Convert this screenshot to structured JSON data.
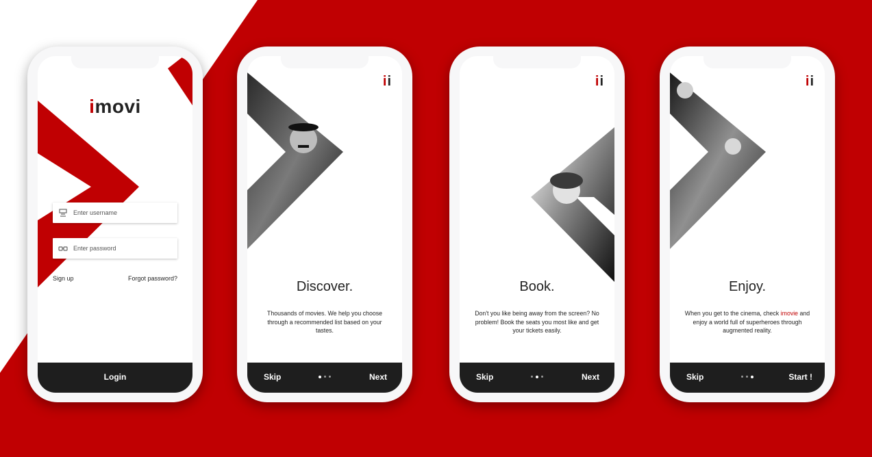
{
  "screens": [
    {
      "type": "login",
      "logo": {
        "accent": "i",
        "rest": "movi"
      },
      "username_placeholder": "Enter username",
      "password_placeholder": "Enter password",
      "signup_label": "Sign up",
      "forgot_label": "Forgot password?",
      "login_label": "Login"
    },
    {
      "type": "onboarding",
      "title": "Discover.",
      "description": "Thousands of movies. We help you choose through a recommended list based on your tastes.",
      "skip_label": "Skip",
      "next_label": "Next",
      "active_step": 1,
      "total_steps": 3
    },
    {
      "type": "onboarding",
      "title": "Book.",
      "description": "Don't you like being away from the screen? No problem! Book the seats you most like and get your tickets easily.",
      "skip_label": "Skip",
      "next_label": "Next",
      "active_step": 2,
      "total_steps": 3
    },
    {
      "type": "onboarding",
      "title": "Enjoy.",
      "description_before": "When you get to the cinema, check ",
      "description_highlight": "imovie",
      "description_after": " and enjoy a world full of superheroes through augmented reality.",
      "skip_label": "Skip",
      "next_label": "Start !",
      "active_step": 3,
      "total_steps": 3
    }
  ],
  "brand_mark": {
    "first": "i",
    "second": "i"
  },
  "colors": {
    "brand_red": "#c00002",
    "bar_dark": "#1e1e1e",
    "text": "#222222"
  },
  "icons": {
    "username": "user-icon",
    "password": "glasses-icon"
  }
}
